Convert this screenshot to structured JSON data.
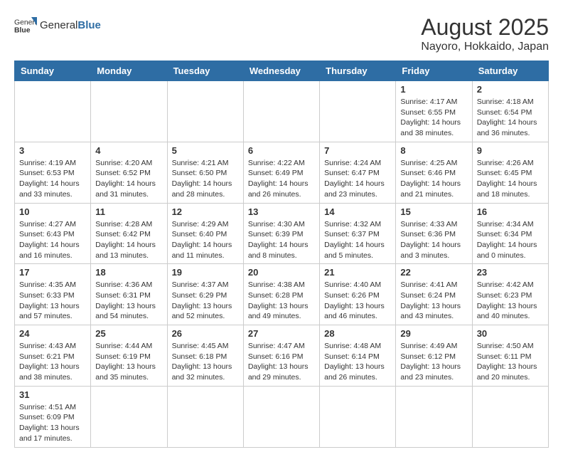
{
  "header": {
    "logo_text_normal": "General",
    "logo_text_bold": "Blue",
    "month_title": "August 2025",
    "location": "Nayoro, Hokkaido, Japan"
  },
  "days_of_week": [
    "Sunday",
    "Monday",
    "Tuesday",
    "Wednesday",
    "Thursday",
    "Friday",
    "Saturday"
  ],
  "weeks": [
    [
      {
        "day": "",
        "info": ""
      },
      {
        "day": "",
        "info": ""
      },
      {
        "day": "",
        "info": ""
      },
      {
        "day": "",
        "info": ""
      },
      {
        "day": "",
        "info": ""
      },
      {
        "day": "1",
        "info": "Sunrise: 4:17 AM\nSunset: 6:55 PM\nDaylight: 14 hours and 38 minutes."
      },
      {
        "day": "2",
        "info": "Sunrise: 4:18 AM\nSunset: 6:54 PM\nDaylight: 14 hours and 36 minutes."
      }
    ],
    [
      {
        "day": "3",
        "info": "Sunrise: 4:19 AM\nSunset: 6:53 PM\nDaylight: 14 hours and 33 minutes."
      },
      {
        "day": "4",
        "info": "Sunrise: 4:20 AM\nSunset: 6:52 PM\nDaylight: 14 hours and 31 minutes."
      },
      {
        "day": "5",
        "info": "Sunrise: 4:21 AM\nSunset: 6:50 PM\nDaylight: 14 hours and 28 minutes."
      },
      {
        "day": "6",
        "info": "Sunrise: 4:22 AM\nSunset: 6:49 PM\nDaylight: 14 hours and 26 minutes."
      },
      {
        "day": "7",
        "info": "Sunrise: 4:24 AM\nSunset: 6:47 PM\nDaylight: 14 hours and 23 minutes."
      },
      {
        "day": "8",
        "info": "Sunrise: 4:25 AM\nSunset: 6:46 PM\nDaylight: 14 hours and 21 minutes."
      },
      {
        "day": "9",
        "info": "Sunrise: 4:26 AM\nSunset: 6:45 PM\nDaylight: 14 hours and 18 minutes."
      }
    ],
    [
      {
        "day": "10",
        "info": "Sunrise: 4:27 AM\nSunset: 6:43 PM\nDaylight: 14 hours and 16 minutes."
      },
      {
        "day": "11",
        "info": "Sunrise: 4:28 AM\nSunset: 6:42 PM\nDaylight: 14 hours and 13 minutes."
      },
      {
        "day": "12",
        "info": "Sunrise: 4:29 AM\nSunset: 6:40 PM\nDaylight: 14 hours and 11 minutes."
      },
      {
        "day": "13",
        "info": "Sunrise: 4:30 AM\nSunset: 6:39 PM\nDaylight: 14 hours and 8 minutes."
      },
      {
        "day": "14",
        "info": "Sunrise: 4:32 AM\nSunset: 6:37 PM\nDaylight: 14 hours and 5 minutes."
      },
      {
        "day": "15",
        "info": "Sunrise: 4:33 AM\nSunset: 6:36 PM\nDaylight: 14 hours and 3 minutes."
      },
      {
        "day": "16",
        "info": "Sunrise: 4:34 AM\nSunset: 6:34 PM\nDaylight: 14 hours and 0 minutes."
      }
    ],
    [
      {
        "day": "17",
        "info": "Sunrise: 4:35 AM\nSunset: 6:33 PM\nDaylight: 13 hours and 57 minutes."
      },
      {
        "day": "18",
        "info": "Sunrise: 4:36 AM\nSunset: 6:31 PM\nDaylight: 13 hours and 54 minutes."
      },
      {
        "day": "19",
        "info": "Sunrise: 4:37 AM\nSunset: 6:29 PM\nDaylight: 13 hours and 52 minutes."
      },
      {
        "day": "20",
        "info": "Sunrise: 4:38 AM\nSunset: 6:28 PM\nDaylight: 13 hours and 49 minutes."
      },
      {
        "day": "21",
        "info": "Sunrise: 4:40 AM\nSunset: 6:26 PM\nDaylight: 13 hours and 46 minutes."
      },
      {
        "day": "22",
        "info": "Sunrise: 4:41 AM\nSunset: 6:24 PM\nDaylight: 13 hours and 43 minutes."
      },
      {
        "day": "23",
        "info": "Sunrise: 4:42 AM\nSunset: 6:23 PM\nDaylight: 13 hours and 40 minutes."
      }
    ],
    [
      {
        "day": "24",
        "info": "Sunrise: 4:43 AM\nSunset: 6:21 PM\nDaylight: 13 hours and 38 minutes."
      },
      {
        "day": "25",
        "info": "Sunrise: 4:44 AM\nSunset: 6:19 PM\nDaylight: 13 hours and 35 minutes."
      },
      {
        "day": "26",
        "info": "Sunrise: 4:45 AM\nSunset: 6:18 PM\nDaylight: 13 hours and 32 minutes."
      },
      {
        "day": "27",
        "info": "Sunrise: 4:47 AM\nSunset: 6:16 PM\nDaylight: 13 hours and 29 minutes."
      },
      {
        "day": "28",
        "info": "Sunrise: 4:48 AM\nSunset: 6:14 PM\nDaylight: 13 hours and 26 minutes."
      },
      {
        "day": "29",
        "info": "Sunrise: 4:49 AM\nSunset: 6:12 PM\nDaylight: 13 hours and 23 minutes."
      },
      {
        "day": "30",
        "info": "Sunrise: 4:50 AM\nSunset: 6:11 PM\nDaylight: 13 hours and 20 minutes."
      }
    ],
    [
      {
        "day": "31",
        "info": "Sunrise: 4:51 AM\nSunset: 6:09 PM\nDaylight: 13 hours and 17 minutes."
      },
      {
        "day": "",
        "info": ""
      },
      {
        "day": "",
        "info": ""
      },
      {
        "day": "",
        "info": ""
      },
      {
        "day": "",
        "info": ""
      },
      {
        "day": "",
        "info": ""
      },
      {
        "day": "",
        "info": ""
      }
    ]
  ]
}
